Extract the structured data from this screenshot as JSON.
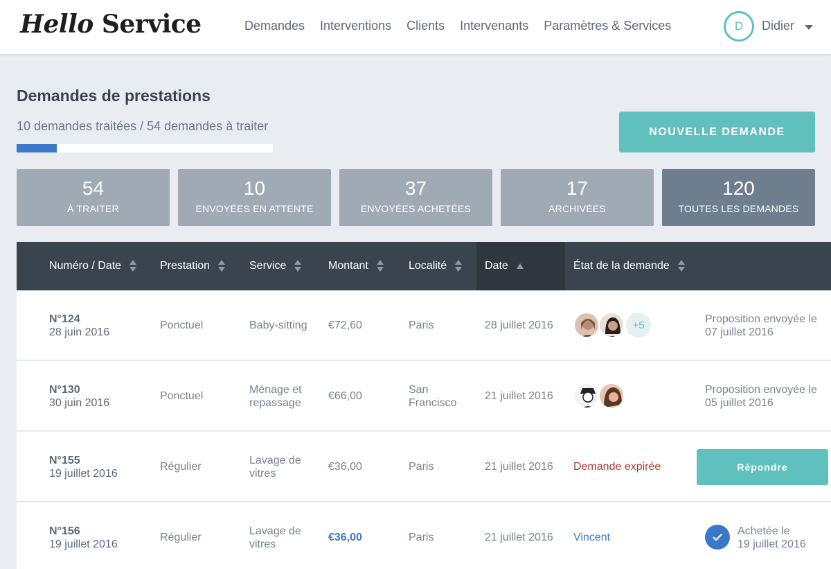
{
  "app": {
    "logo_part1": "Hello",
    "logo_part2": "Service"
  },
  "nav": [
    "Demandes",
    "Interventions",
    "Clients",
    "Intervenants",
    "Paramètres & Services"
  ],
  "user": {
    "initial": "D",
    "name": "Didier"
  },
  "page": {
    "title": "Demandes de prestations",
    "progress_text": "10 demandes traitées / 54 demandes à traiter",
    "progress_fraction": 0.157,
    "new_button": "NOUVELLE DEMANDE"
  },
  "stats": [
    {
      "value": "54",
      "label": "À TRAITER"
    },
    {
      "value": "10",
      "label": "ENVOYÉES EN ATTENTE"
    },
    {
      "value": "37",
      "label": "ENVOYÉES ACHETÉES"
    },
    {
      "value": "17",
      "label": "ARCHIVÉES"
    },
    {
      "value": "120",
      "label": "TOUTES LES DEMANDES"
    }
  ],
  "table": {
    "headers": [
      "Numéro / Date",
      "Prestation",
      "Service",
      "Montant",
      "Localité",
      "Date",
      "État de la demande"
    ],
    "rows": [
      {
        "number": "N°124",
        "created": "28 juin 2016",
        "prestation": "Ponctuel",
        "service1": "Baby-sitting",
        "service2": "",
        "amount": "€72,60",
        "loc1": "Paris",
        "loc2": "",
        "date": "28 juillet 2016",
        "more": "+5",
        "status1": "Proposition envoyée le",
        "status2": "07 juillet 2016"
      },
      {
        "number": "N°130",
        "created": "30 juin 2016",
        "prestation": "Ponctuel",
        "service1": "Ménage et",
        "service2": "repassage",
        "amount": "€66,00",
        "loc1": "San",
        "loc2": "Francisco",
        "date": "21 juillet 2016",
        "status1": "Proposition envoyée le",
        "status2": "05 juillet 2016"
      },
      {
        "number": "N°155",
        "created": "19 juillet 2016",
        "prestation": "Régulier",
        "service1": "Lavage de",
        "service2": "vitres",
        "amount": "€36,00",
        "loc1": "Paris",
        "loc2": "",
        "date": "21 juillet 2016",
        "state": "Demande expirée",
        "action": "Répondre"
      },
      {
        "number": "N°156",
        "created": "19 juillet 2016",
        "prestation": "Régulier",
        "service1": "Lavage de",
        "service2": "vitres",
        "amount": "€36,00",
        "loc1": "Paris",
        "loc2": "",
        "date": "21 juillet 2016",
        "state": "Vincent",
        "status1": "Achetée le",
        "status2": "19 juillet 2016"
      }
    ]
  },
  "colors": {
    "accent": "#5fc0be",
    "blue": "#3a78c9",
    "expired": "#b33a35",
    "header": "#3a444e"
  }
}
